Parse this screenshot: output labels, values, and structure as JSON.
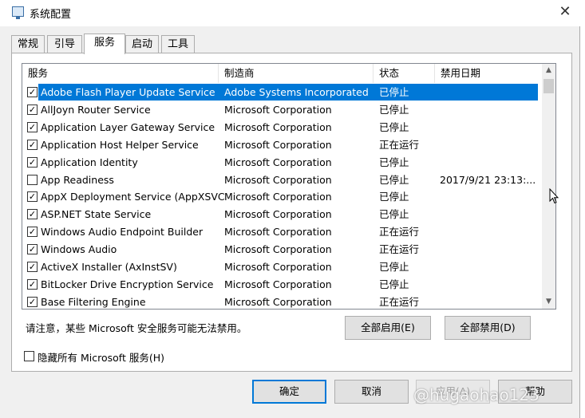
{
  "window": {
    "title": "系统配置",
    "close_glyph": "✕"
  },
  "tabs": [
    {
      "label": "常规"
    },
    {
      "label": "引导"
    },
    {
      "label": "服务"
    },
    {
      "label": "启动"
    },
    {
      "label": "工具"
    }
  ],
  "active_tab": "服务",
  "columns": {
    "service": "服务",
    "maker": "制造商",
    "status": "状态",
    "disabled_date": "禁用日期"
  },
  "services": [
    {
      "checked": true,
      "name": "Adobe Flash Player Update Service",
      "maker": "Adobe Systems Incorporated",
      "status": "已停止",
      "date": "",
      "selected": true
    },
    {
      "checked": true,
      "name": "AllJoyn Router Service",
      "maker": "Microsoft Corporation",
      "status": "已停止",
      "date": ""
    },
    {
      "checked": true,
      "name": "Application Layer Gateway Service",
      "maker": "Microsoft Corporation",
      "status": "已停止",
      "date": ""
    },
    {
      "checked": true,
      "name": "Application Host Helper Service",
      "maker": "Microsoft Corporation",
      "status": "正在运行",
      "date": ""
    },
    {
      "checked": true,
      "name": "Application Identity",
      "maker": "Microsoft Corporation",
      "status": "已停止",
      "date": ""
    },
    {
      "checked": false,
      "name": "App Readiness",
      "maker": "Microsoft Corporation",
      "status": "已停止",
      "date": "2017/9/21 23:13:..."
    },
    {
      "checked": true,
      "name": "AppX Deployment Service (AppXSVC)",
      "maker": "Microsoft Corporation",
      "status": "已停止",
      "date": ""
    },
    {
      "checked": true,
      "name": "ASP.NET State Service",
      "maker": "Microsoft Corporation",
      "status": "已停止",
      "date": ""
    },
    {
      "checked": true,
      "name": "Windows Audio Endpoint Builder",
      "maker": "Microsoft Corporation",
      "status": "正在运行",
      "date": ""
    },
    {
      "checked": true,
      "name": "Windows Audio",
      "maker": "Microsoft Corporation",
      "status": "正在运行",
      "date": ""
    },
    {
      "checked": true,
      "name": "ActiveX Installer (AxInstSV)",
      "maker": "Microsoft Corporation",
      "status": "已停止",
      "date": ""
    },
    {
      "checked": true,
      "name": "BitLocker Drive Encryption Service",
      "maker": "Microsoft Corporation",
      "status": "已停止",
      "date": ""
    },
    {
      "checked": true,
      "name": "Base Filtering Engine",
      "maker": "Microsoft Corporation",
      "status": "正在运行",
      "date": ""
    }
  ],
  "notice": "请注意，某些 Microsoft 安全服务可能无法禁用。",
  "buttons": {
    "enable_all": "全部启用(E)",
    "disable_all": "全部禁用(D)",
    "ok": "确定",
    "cancel": "取消",
    "apply": "应用(A)",
    "help": "帮助"
  },
  "hide_ms_services": {
    "label": "隐藏所有 Microsoft 服务(H)",
    "checked": false
  },
  "watermark": "@hugaohao123",
  "colors": {
    "selection": "#0078d7",
    "default_button_border": "#0078d7"
  }
}
